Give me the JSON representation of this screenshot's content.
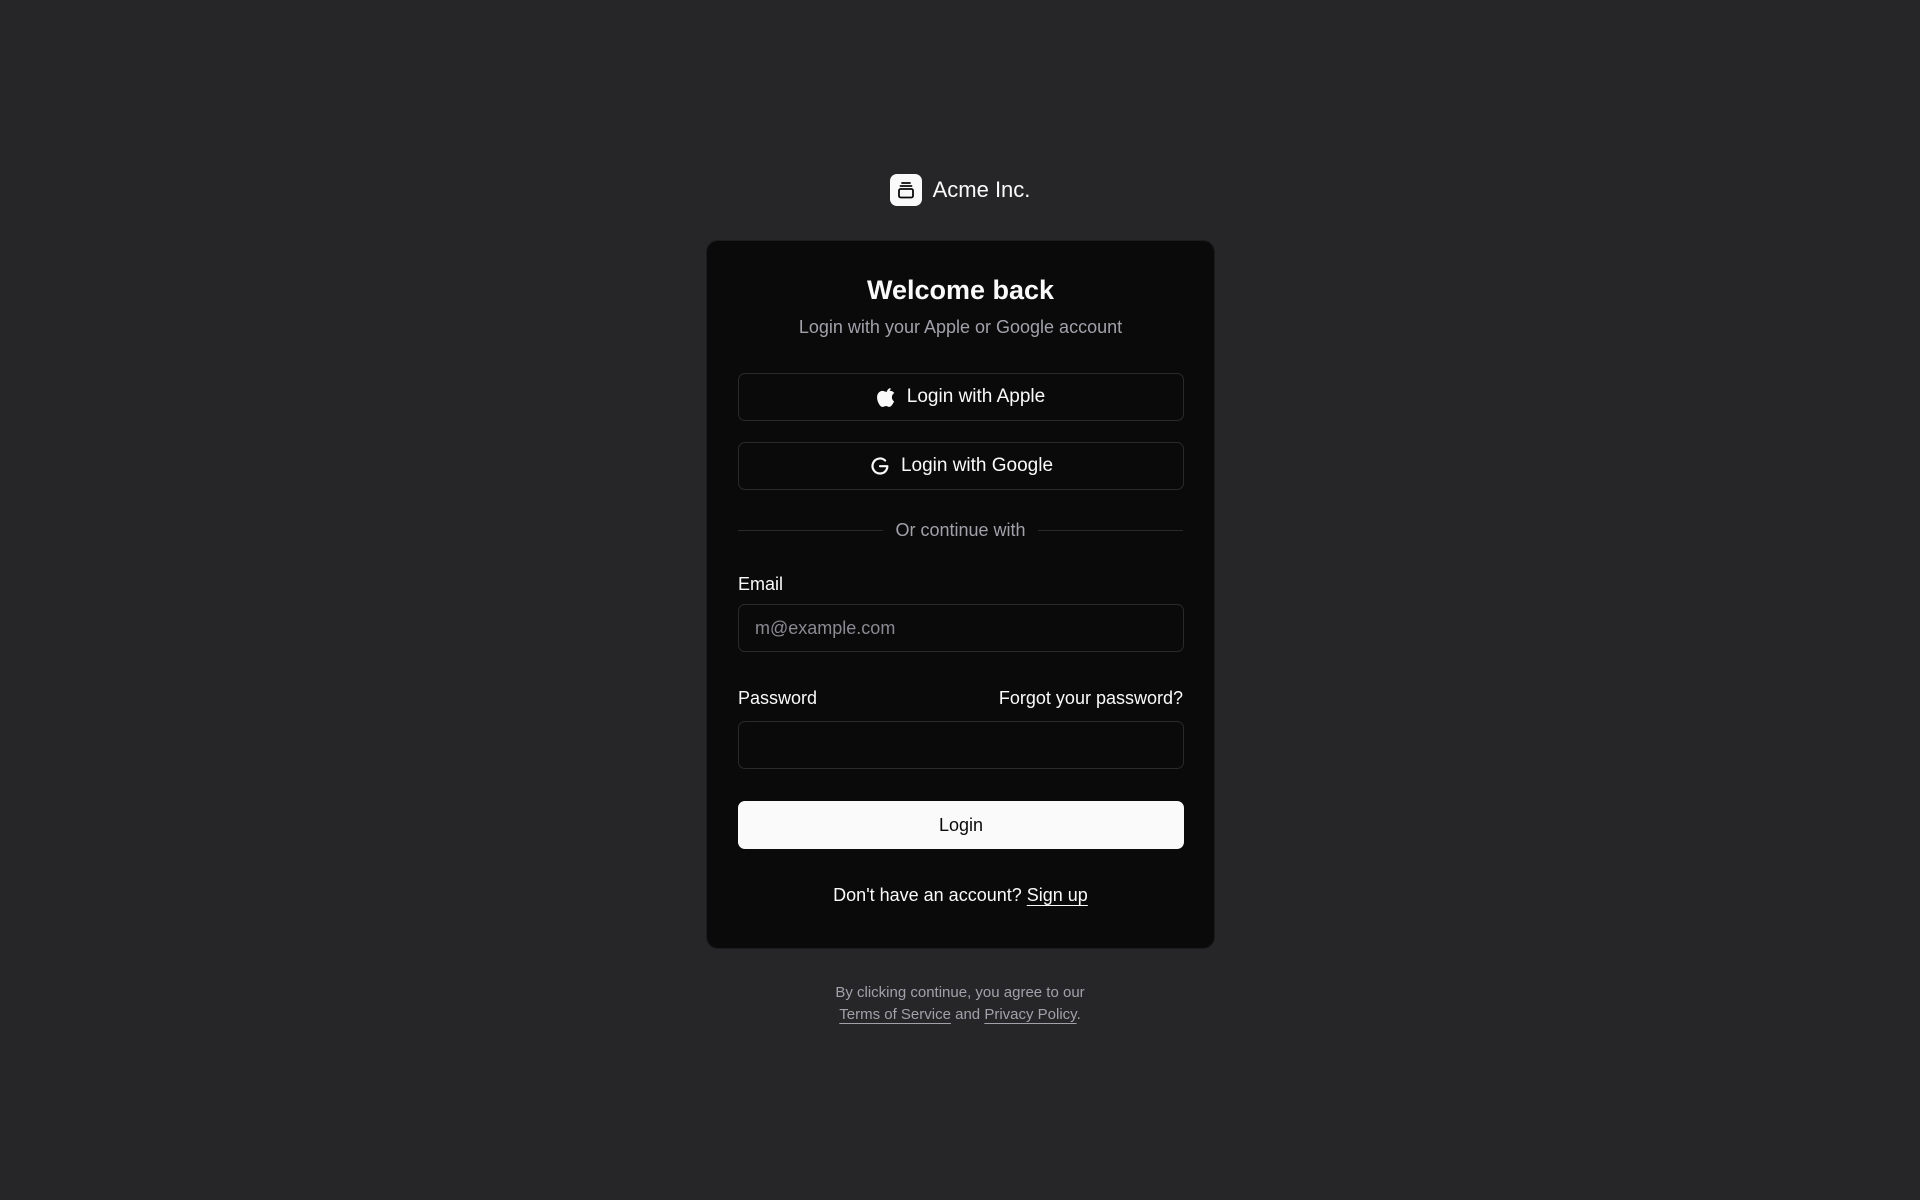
{
  "brand": {
    "name": "Acme Inc.",
    "logo_icon": "gallery-stack-icon"
  },
  "card": {
    "title": "Welcome back",
    "subtitle": "Login with your Apple or Google account",
    "apple_button": {
      "label": "Login with Apple",
      "icon": "apple-icon"
    },
    "google_button": {
      "label": "Login with Google",
      "icon": "google-icon"
    },
    "divider_text": "Or continue with",
    "email": {
      "label": "Email",
      "placeholder": "m@example.com",
      "value": ""
    },
    "password": {
      "label": "Password",
      "value": "",
      "forgot_link": "Forgot your password?"
    },
    "login_button": "Login",
    "signup": {
      "prompt": "Don't have an account?",
      "link": "Sign up"
    }
  },
  "footer": {
    "line1": "By clicking continue, you agree to our",
    "terms_link": "Terms of Service",
    "and_text": "and",
    "privacy_link": "Privacy Policy",
    "period": "."
  },
  "colors": {
    "background": "#262628",
    "card": "#0a0a0b",
    "border": "#2a2a2d",
    "text": "#fafafa",
    "muted": "#a1a1aa",
    "primary_button": "#fafafa"
  }
}
